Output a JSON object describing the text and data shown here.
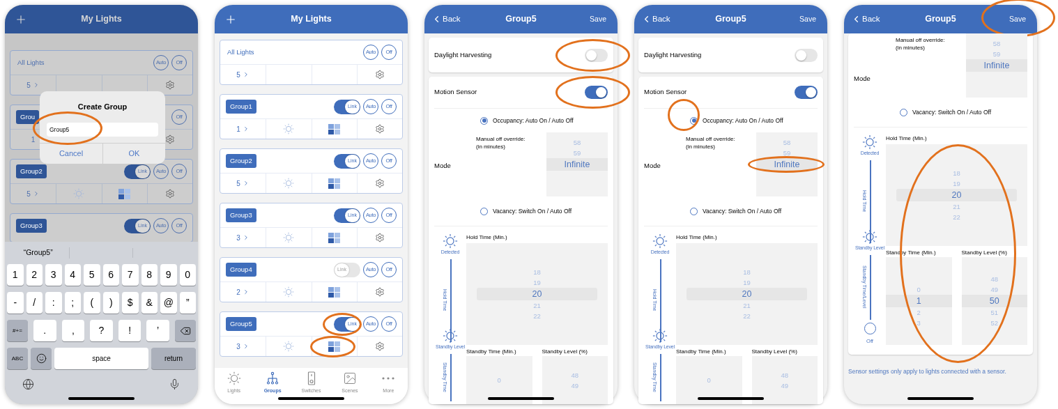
{
  "screens": [
    {
      "kind": "groups",
      "dimmed": true,
      "title": "My Lights",
      "cards": [
        {
          "kind": "all",
          "name": "All Lights",
          "auto": "Auto",
          "off": "Off",
          "count": "5",
          "covered": false
        },
        {
          "kind": "group",
          "name": "Grou",
          "off": "Off",
          "count": "1",
          "covered": true
        },
        {
          "kind": "group",
          "name": "Group2",
          "link": {
            "label": "Link",
            "on": true
          },
          "auto": "Auto",
          "off": "Off",
          "count": "5",
          "covered": false
        },
        {
          "kind": "group",
          "name": "Group3",
          "link": {
            "label": "Link",
            "on": true
          },
          "auto": "Auto",
          "off": "Off"
        }
      ],
      "dialog": {
        "title": "Create Group",
        "input": {
          "value": "Group5",
          "circled": true
        },
        "buttons": [
          "Cancel",
          "OK"
        ]
      },
      "keyboard": {
        "suggestion": "“Group5”",
        "key_rows": [
          [
            {
              "kind": "char",
              "label": "1"
            },
            {
              "kind": "char",
              "label": "2"
            },
            {
              "kind": "char",
              "label": "3"
            },
            {
              "kind": "char",
              "label": "4"
            },
            {
              "kind": "char",
              "label": "5"
            },
            {
              "kind": "char",
              "label": "6"
            },
            {
              "kind": "char",
              "label": "7"
            },
            {
              "kind": "char",
              "label": "8"
            },
            {
              "kind": "char",
              "label": "9"
            },
            {
              "kind": "char",
              "label": "0"
            }
          ],
          [
            {
              "kind": "char",
              "label": "-"
            },
            {
              "kind": "char",
              "label": "/"
            },
            {
              "kind": "char",
              "label": ":"
            },
            {
              "kind": "char",
              "label": ";"
            },
            {
              "kind": "char",
              "label": "("
            },
            {
              "kind": "char",
              "label": ")"
            },
            {
              "kind": "char",
              "label": "$"
            },
            {
              "kind": "char",
              "label": "&"
            },
            {
              "kind": "char",
              "label": "@"
            },
            {
              "kind": "char",
              "label": "”"
            }
          ],
          [
            {
              "kind": "function",
              "label": "#+="
            },
            {
              "kind": "char",
              "label": "."
            },
            {
              "kind": "char",
              "label": ","
            },
            {
              "kind": "char",
              "label": "?"
            },
            {
              "kind": "char",
              "label": "!"
            },
            {
              "kind": "char",
              "label": "’"
            },
            {
              "kind": "delete"
            }
          ],
          [
            {
              "kind": "function",
              "label": "ABC"
            },
            {
              "kind": "emoji"
            },
            {
              "kind": "space",
              "label": "space"
            },
            {
              "kind": "function",
              "label": "return"
            }
          ]
        ]
      }
    },
    {
      "kind": "groups",
      "dimmed": false,
      "title": "My Lights",
      "cards": [
        {
          "kind": "all",
          "name": "All Lights",
          "auto": "Auto",
          "off": "Off",
          "count": "5",
          "covered": false
        },
        {
          "kind": "group",
          "name": "Group1",
          "link": {
            "label": "Link",
            "on": true
          },
          "auto": "Auto",
          "off": "Off",
          "count": "1",
          "covered": false
        },
        {
          "kind": "group",
          "name": "Group2",
          "link": {
            "label": "Link",
            "on": true
          },
          "auto": "Auto",
          "off": "Off",
          "count": "5",
          "covered": false
        },
        {
          "kind": "group",
          "name": "Group3",
          "link": {
            "label": "Link",
            "on": true
          },
          "auto": "Auto",
          "off": "Off",
          "count": "3",
          "covered": false
        },
        {
          "kind": "group",
          "name": "Group4",
          "link": {
            "label": "Link",
            "on": false
          },
          "auto": "Auto",
          "off": "Off",
          "count": "2",
          "covered": false
        },
        {
          "kind": "group",
          "name": "Group5",
          "link": {
            "label": "Link",
            "on": true,
            "circled": true
          },
          "auto": "Auto",
          "off": "Off",
          "count": "3",
          "covered": false,
          "scenes_circled": true
        }
      ],
      "tabs": [
        {
          "kind": "sun",
          "label": "Lights",
          "selected": false
        },
        {
          "kind": "tree",
          "label": "Groups",
          "selected": true
        },
        {
          "kind": "switch",
          "label": "Switches",
          "selected": false
        },
        {
          "kind": "image",
          "label": "Scenes",
          "selected": false
        },
        {
          "kind": "dots",
          "label": "More",
          "selected": false
        }
      ]
    },
    {
      "kind": "settings",
      "header": {
        "back": "Back",
        "title": "Group5",
        "save": "Save"
      },
      "daylight": {
        "label": "Daylight Harvesting",
        "on": false,
        "circled": true
      },
      "motion": {
        "label": "Motion Sensor",
        "on": true,
        "circled": true
      },
      "mode": {
        "label": "Mode",
        "items": [
          {
            "kind": "radio",
            "label": "Occupancy: Auto On / Auto Off",
            "selected": true
          },
          {
            "kind": "override",
            "label": "Manual off override:\n(in minutes)",
            "values": [
              {
                "value": "58",
                "selected": false
              },
              {
                "value": "59",
                "selected": false
              },
              {
                "value": "Infinite",
                "selected": true
              }
            ]
          },
          {
            "kind": "radio",
            "label": "Vacancy: Switch On / Auto Off",
            "selected": false
          }
        ]
      },
      "timeline": {
        "stages": [
          {
            "kind": "sun",
            "label": "Detected"
          },
          {
            "kind": "line",
            "label": "Hold Time"
          },
          {
            "kind": "sun",
            "label": "Standby Level"
          },
          {
            "kind": "line",
            "label": "Standby Time"
          }
        ],
        "hold": {
          "label": "Hold Time (Min.)",
          "values": [
            {
              "value": "18",
              "selected": false
            },
            {
              "value": "19",
              "selected": false
            },
            {
              "value": "20",
              "selected": true
            },
            {
              "value": "21",
              "selected": false
            },
            {
              "value": "22",
              "selected": false
            }
          ]
        },
        "standby_time": {
          "label": "Standby Time (Min.)",
          "values": [
            {
              "value": "0",
              "selected": false
            }
          ]
        },
        "standby_level": {
          "label": "Standby Level (%)",
          "values": [
            {
              "value": "48",
              "selected": false
            },
            {
              "value": "49",
              "selected": false
            }
          ]
        }
      }
    },
    {
      "kind": "settings",
      "header": {
        "back": "Back",
        "title": "Group5",
        "save": "Save"
      },
      "daylight": {
        "label": "Daylight Harvesting",
        "on": false
      },
      "motion": {
        "label": "Motion Sensor",
        "on": true
      },
      "mode": {
        "label": "Mode",
        "items": [
          {
            "kind": "radio",
            "label": "Occupancy: Auto On / Auto Off",
            "selected": true,
            "circled": true
          },
          {
            "kind": "override",
            "label": "Manual off override:\n(in minutes)",
            "circled": true,
            "values": [
              {
                "value": "58",
                "selected": false
              },
              {
                "value": "59",
                "selected": false
              },
              {
                "value": "Infinite",
                "selected": true
              }
            ]
          },
          {
            "kind": "radio",
            "label": "Vacancy: Switch On / Auto Off",
            "selected": false
          }
        ]
      },
      "timeline": {
        "stages": [
          {
            "kind": "sun",
            "label": "Detected"
          },
          {
            "kind": "line",
            "label": "Hold Time"
          },
          {
            "kind": "sun",
            "label": "Standby Level"
          },
          {
            "kind": "line",
            "label": "Standby Time"
          }
        ],
        "hold": {
          "label": "Hold Time (Min.)",
          "values": [
            {
              "value": "18",
              "selected": false
            },
            {
              "value": "19",
              "selected": false
            },
            {
              "value": "20",
              "selected": true
            },
            {
              "value": "21",
              "selected": false
            },
            {
              "value": "22",
              "selected": false
            }
          ]
        },
        "standby_time": {
          "label": "Standby Time (Min.)",
          "values": [
            {
              "value": "0",
              "selected": false
            }
          ]
        },
        "standby_level": {
          "label": "Standby Level (%)",
          "values": [
            {
              "value": "48",
              "selected": false
            },
            {
              "value": "49",
              "selected": false
            }
          ]
        }
      }
    },
    {
      "kind": "settings",
      "header": {
        "back": "Back",
        "title": "Group5",
        "save": "Save",
        "save_circled": true
      },
      "mode": {
        "label": "Mode",
        "items": [
          {
            "kind": "override",
            "label": "Manual off override:\n(in minutes)",
            "values": [
              {
                "value": "58",
                "selected": false
              },
              {
                "value": "59",
                "selected": false
              },
              {
                "value": "Infinite",
                "selected": true
              }
            ]
          },
          {
            "kind": "radio",
            "label": "Vacancy: Switch On / Auto Off",
            "selected": false
          }
        ]
      },
      "timeline": {
        "circled": true,
        "stages": [
          {
            "kind": "sun",
            "label": "Detected"
          },
          {
            "kind": "line",
            "label": "Hold Time"
          },
          {
            "kind": "sun",
            "label": "Standby Level"
          },
          {
            "kind": "line",
            "label": "Standby Time/Level"
          },
          {
            "kind": "circle",
            "label": "Off"
          }
        ],
        "hold": {
          "label": "Hold Time (Min.)",
          "values": [
            {
              "value": "18",
              "selected": false
            },
            {
              "value": "19",
              "selected": false
            },
            {
              "value": "20",
              "selected": true
            },
            {
              "value": "21",
              "selected": false
            },
            {
              "value": "22",
              "selected": false
            }
          ]
        },
        "standby_time": {
          "label": "Standby Time (Min.)",
          "values": [
            {
              "value": "0",
              "selected": false
            },
            {
              "value": "1",
              "selected": true
            },
            {
              "value": "2",
              "selected": false
            },
            {
              "value": "3",
              "selected": false
            }
          ]
        },
        "standby_level": {
          "label": "Standby Level (%)",
          "values": [
            {
              "value": "48",
              "selected": false
            },
            {
              "value": "49",
              "selected": false
            },
            {
              "value": "50",
              "selected": true
            },
            {
              "value": "51",
              "selected": false
            },
            {
              "value": "52",
              "selected": false
            }
          ]
        }
      },
      "note": "Sensor settings only apply to lights connected with a sensor."
    }
  ]
}
